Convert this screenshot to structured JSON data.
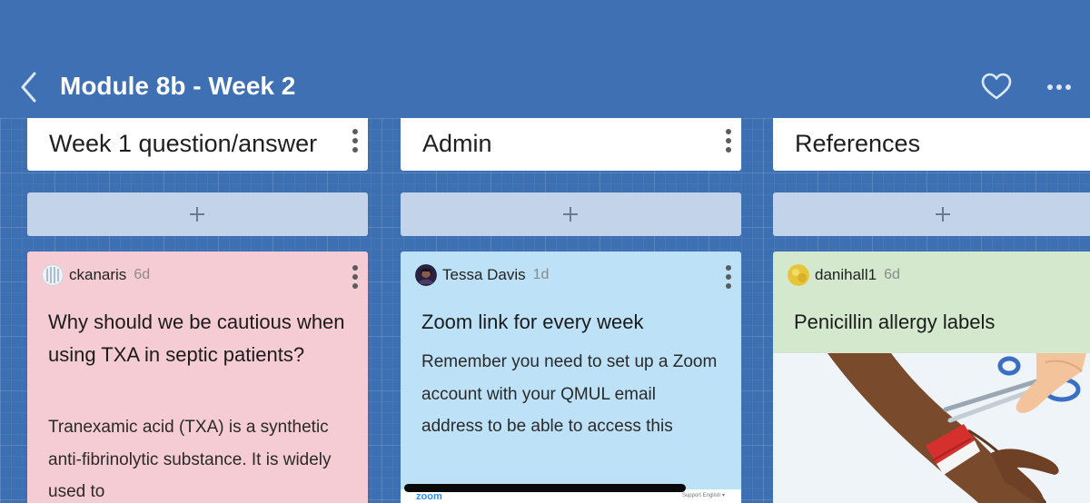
{
  "header": {
    "title": "Module 8b - Week 2",
    "background": "#3f70b4",
    "icons": [
      "back-chevron",
      "heart-outline",
      "more-horizontal"
    ]
  },
  "columns": [
    {
      "title": "Week 1 question/answer",
      "post": {
        "author": "ckanaris",
        "age": "6d",
        "subject": "Why should we be cautious when using TXA in septic patients?",
        "body": "Tranexamic acid (TXA) is  a synthetic anti-fibrinolytic substance. It is widely used to",
        "color": "#f6ccd4"
      }
    },
    {
      "title": "Admin",
      "post": {
        "author": "Tessa Davis",
        "age": "1d",
        "subject": "Zoom link for every week",
        "body": "Remember you need to set up a Zoom account with your QMUL email address to be able to access this",
        "color": "#bde2f7",
        "attachment": {
          "logo": "zoom",
          "links": "Support    English ▾"
        }
      }
    },
    {
      "title": "References",
      "post": {
        "author": "danihall1",
        "age": "6d",
        "subject": "Penicillin allergy labels",
        "color": "#d4e8ce",
        "attachment": {
          "type": "image",
          "subject": "scissors cutting red allergy wristband"
        }
      }
    }
  ],
  "add_post_symbol": "+"
}
